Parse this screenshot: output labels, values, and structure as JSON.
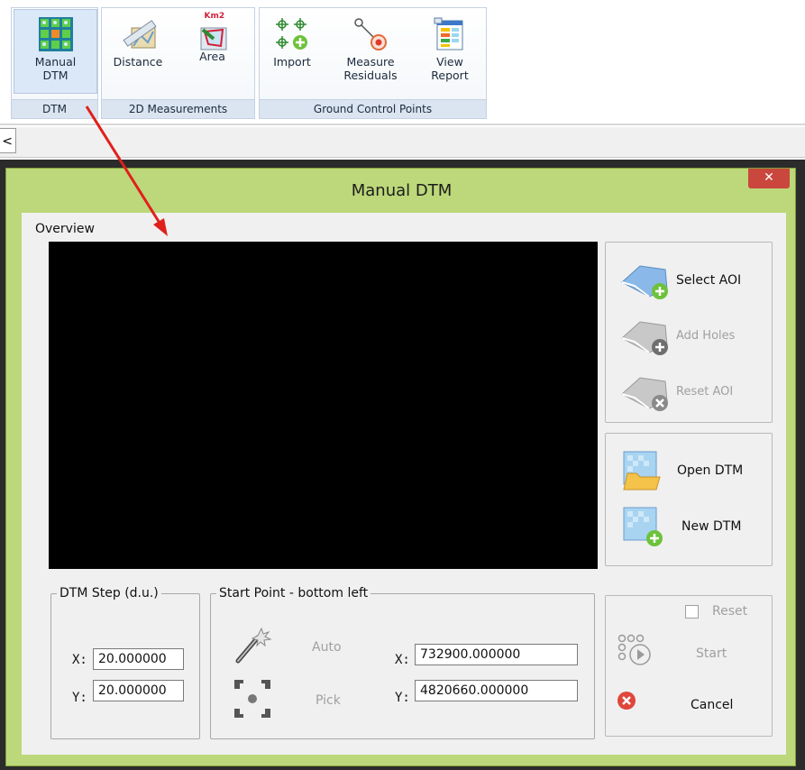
{
  "ribbon": {
    "groups": [
      {
        "caption": "DTM",
        "buttons": [
          {
            "label1": "Manual",
            "label2": "DTM",
            "icon": "manual-dtm-icon"
          }
        ]
      },
      {
        "caption": "2D Measurements",
        "buttons": [
          {
            "label1": "Distance",
            "label2": "",
            "icon": "distance-icon"
          },
          {
            "label1": "Area",
            "label2": "",
            "icon": "area-icon"
          }
        ]
      },
      {
        "caption": "Ground Control Points",
        "buttons": [
          {
            "label1": "Import",
            "label2": "",
            "icon": "import-gcp-icon"
          },
          {
            "label1": "Measure",
            "label2": "Residuals",
            "icon": "measure-residuals-icon"
          },
          {
            "label1": "View",
            "label2": "Report",
            "icon": "view-report-icon"
          }
        ]
      }
    ],
    "area_badge": "Km2"
  },
  "tabstub_text": "<",
  "dialog": {
    "title": "Manual DTM",
    "close": "✕",
    "overview_label": "Overview",
    "aoi_buttons": [
      {
        "label": "Select AOI",
        "enabled": true,
        "icon": "select-aoi-icon"
      },
      {
        "label": "Add Holes",
        "enabled": false,
        "icon": "add-holes-icon"
      },
      {
        "label": "Reset AOI",
        "enabled": false,
        "icon": "reset-aoi-icon"
      }
    ],
    "dtm_buttons": [
      {
        "label": "Open DTM",
        "icon": "open-dtm-icon"
      },
      {
        "label": "New DTM",
        "icon": "new-dtm-icon"
      }
    ],
    "dtm_step": {
      "legend": "DTM Step (d.u.)",
      "x_label": "X:",
      "x_value": "20.000000",
      "y_label": "Y:",
      "y_value": "20.000000"
    },
    "start_point": {
      "legend": "Start Point - bottom left",
      "auto_label": "Auto",
      "pick_label": "Pick",
      "x_label": "X:",
      "x_value": "732900.000000",
      "y_label": "Y:",
      "y_value": "4820660.000000"
    },
    "actions": {
      "reset_label": "Reset",
      "start_label": "Start",
      "cancel_label": "Cancel"
    }
  },
  "colors": {
    "dialog_frame": "#bcd87a",
    "close_button": "#c9473d",
    "annotation_arrow": "#e0201c",
    "overview_bg": "#000000"
  }
}
